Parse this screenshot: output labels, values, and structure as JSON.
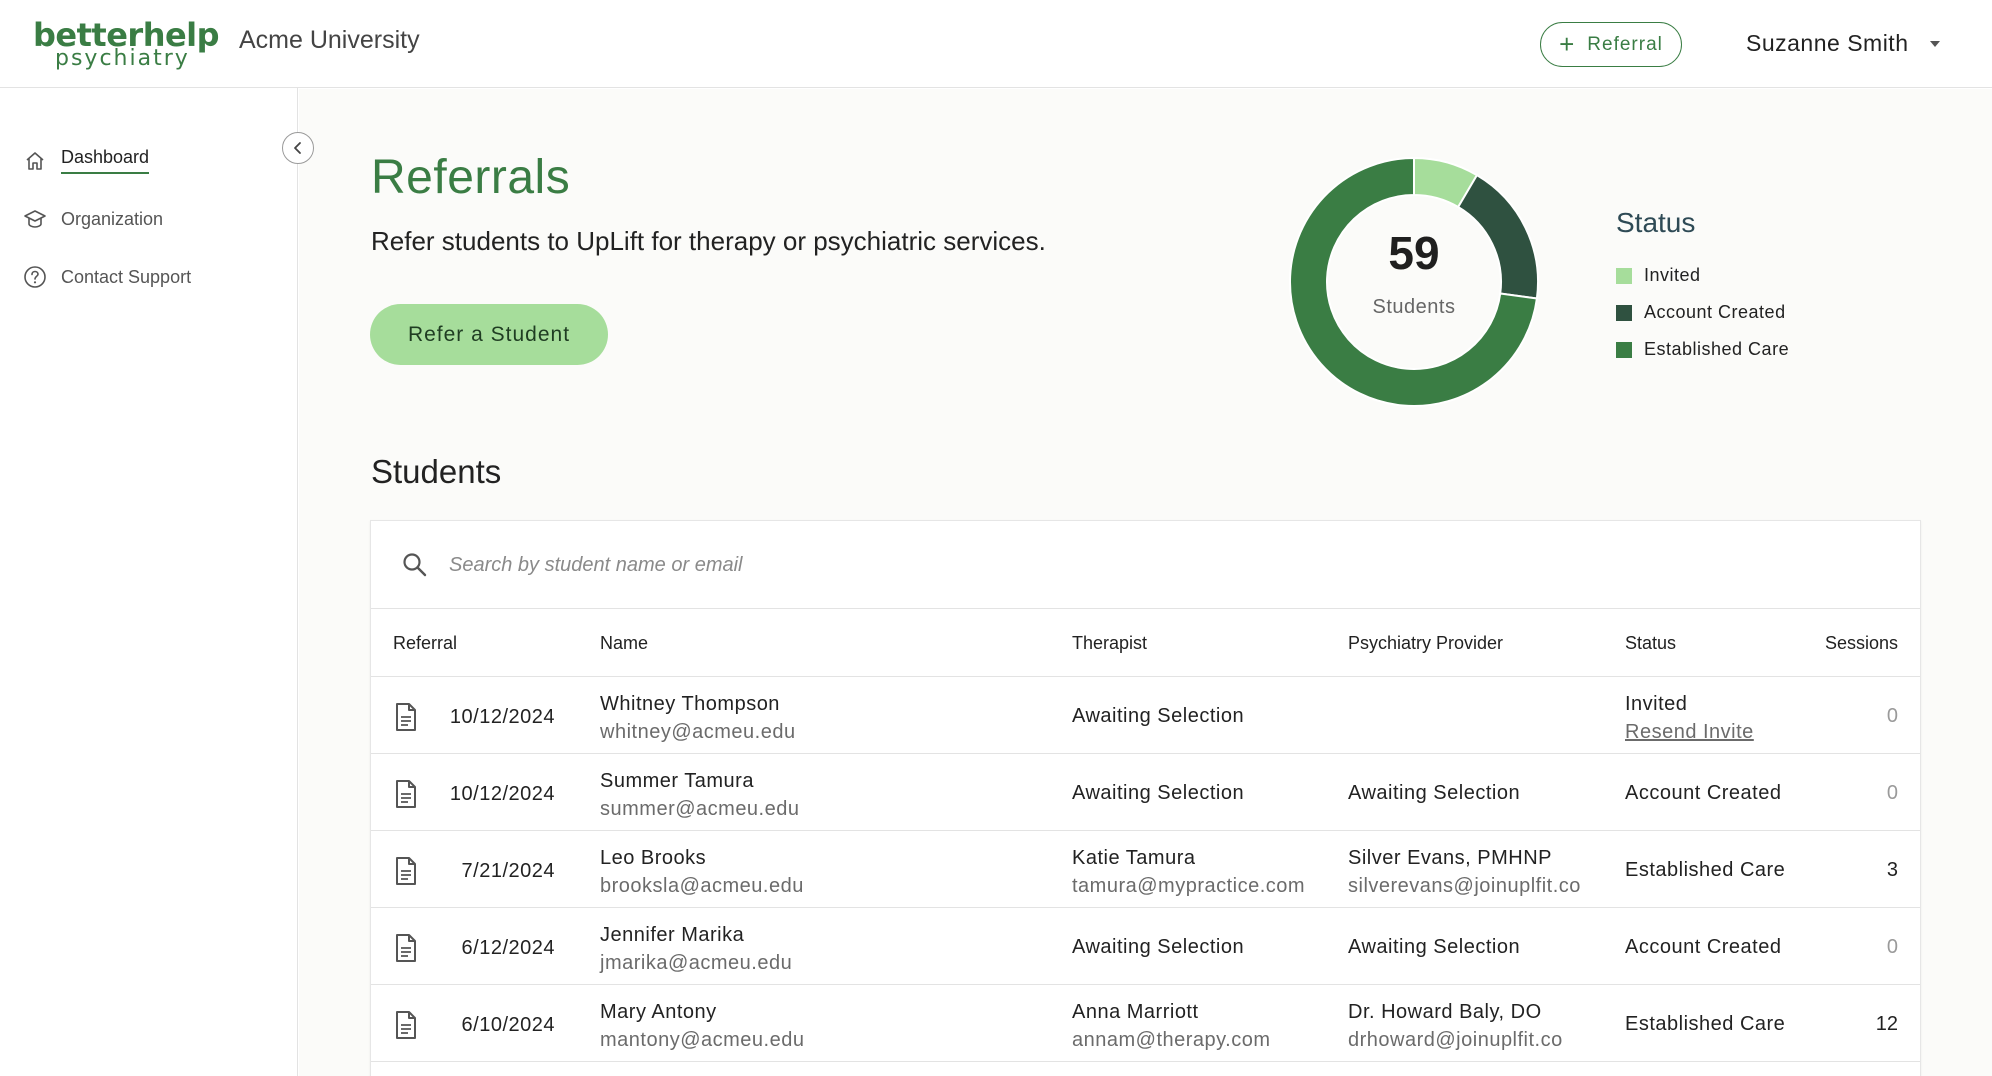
{
  "header": {
    "logo_top": "betterhelp",
    "logo_bottom": "psychiatry",
    "org_name": "Acme University",
    "referral_button": "Referral",
    "user_name": "Suzanne Smith"
  },
  "sidebar": {
    "items": [
      {
        "label": "Dashboard",
        "icon": "home-icon",
        "active": true
      },
      {
        "label": "Organization",
        "icon": "graduation-cap-icon",
        "active": false
      },
      {
        "label": "Contact Support",
        "icon": "help-circle-icon",
        "active": false
      }
    ]
  },
  "main": {
    "title": "Referrals",
    "subtitle": "Refer students to UpLift for therapy or psychiatric services.",
    "refer_button": "Refer a Student",
    "students_heading": "Students"
  },
  "chart_data": {
    "type": "pie",
    "center_value": "59",
    "center_label": "Students",
    "legend_title": "Status",
    "categories": [
      "Invited",
      "Account Created",
      "Established Care"
    ],
    "values": [
      5,
      11,
      43
    ],
    "colors": [
      "#a6dd9b",
      "#2f5140",
      "#3a7d44"
    ]
  },
  "search": {
    "placeholder": "Search by student name or email"
  },
  "table": {
    "headers": {
      "referral": "Referral",
      "name": "Name",
      "therapist": "Therapist",
      "psychiatry": "Psychiatry Provider",
      "status": "Status",
      "sessions": "Sessions"
    },
    "rows": [
      {
        "date": "10/12/2024",
        "name": "Whitney Thompson",
        "email": "whitney@acmeu.edu",
        "therapist": "Awaiting Selection",
        "therapist_email": "",
        "psychiatry": "",
        "psychiatry_email": "",
        "status": "Invited",
        "status_action": "Resend Invite",
        "sessions": "0"
      },
      {
        "date": "10/12/2024",
        "name": "Summer Tamura",
        "email": "summer@acmeu.edu",
        "therapist": "Awaiting Selection",
        "therapist_email": "",
        "psychiatry": "Awaiting Selection",
        "psychiatry_email": "",
        "status": "Account Created",
        "status_action": "",
        "sessions": "0"
      },
      {
        "date": "7/21/2024",
        "name": "Leo Brooks",
        "email": "brooksla@acmeu.edu",
        "therapist": "Katie Tamura",
        "therapist_email": "tamura@mypractice.com",
        "psychiatry": "Silver Evans, PMHNP",
        "psychiatry_email": "silverevans@joinuplfit.co",
        "status": "Established Care",
        "status_action": "",
        "sessions": "3"
      },
      {
        "date": "6/12/2024",
        "name": "Jennifer Marika",
        "email": "jmarika@acmeu.edu",
        "therapist": "Awaiting Selection",
        "therapist_email": "",
        "psychiatry": "Awaiting Selection",
        "psychiatry_email": "",
        "status": "Account Created",
        "status_action": "",
        "sessions": "0"
      },
      {
        "date": "6/10/2024",
        "name": "Mary Antony",
        "email": "mantony@acmeu.edu",
        "therapist": "Anna Marriott",
        "therapist_email": "annam@therapy.com",
        "psychiatry": "Dr. Howard Baly, DO",
        "psychiatry_email": "drhoward@joinuplfit.co",
        "status": "Established Care",
        "status_action": "",
        "sessions": "12"
      }
    ]
  }
}
